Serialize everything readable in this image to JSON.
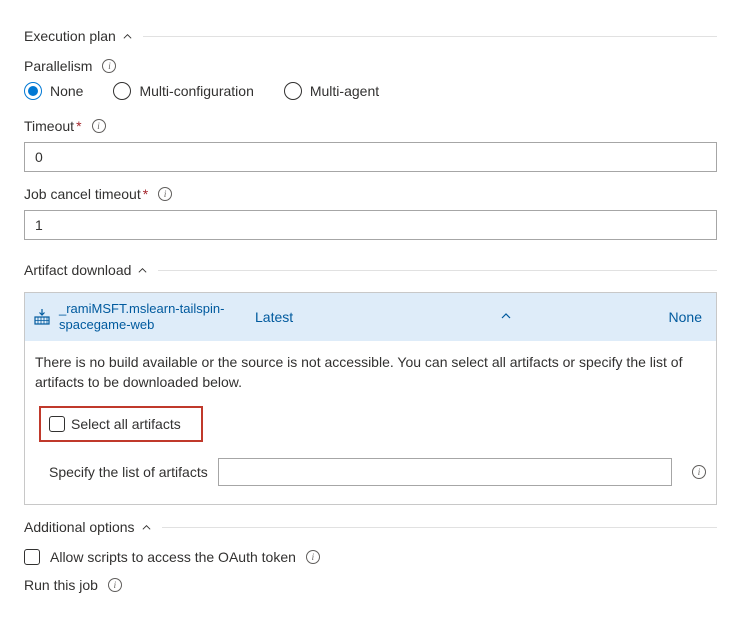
{
  "sections": {
    "execution_plan": {
      "title": "Execution plan"
    },
    "artifact_download": {
      "title": "Artifact download"
    },
    "additional_options": {
      "title": "Additional options"
    }
  },
  "parallelism": {
    "label": "Parallelism",
    "options": {
      "none": "None",
      "multi_config": "Multi-configuration",
      "multi_agent": "Multi-agent"
    },
    "selected": "none"
  },
  "timeout": {
    "label": "Timeout",
    "value": "0"
  },
  "job_cancel_timeout": {
    "label": "Job cancel timeout",
    "value": "1"
  },
  "artifact": {
    "name": "_ramiMSFT.mslearn-tailspin-spacegame-web",
    "version_label": "Latest",
    "none_label": "None",
    "message": "There is no build available or the source is not accessible. You can select all artifacts or specify the list of artifacts to be downloaded below.",
    "select_all_label": "Select all artifacts",
    "specify_label": "Specify the list of artifacts",
    "specify_value": ""
  },
  "additional": {
    "oauth_label": "Allow scripts to access the OAuth token",
    "run_label": "Run this job"
  }
}
